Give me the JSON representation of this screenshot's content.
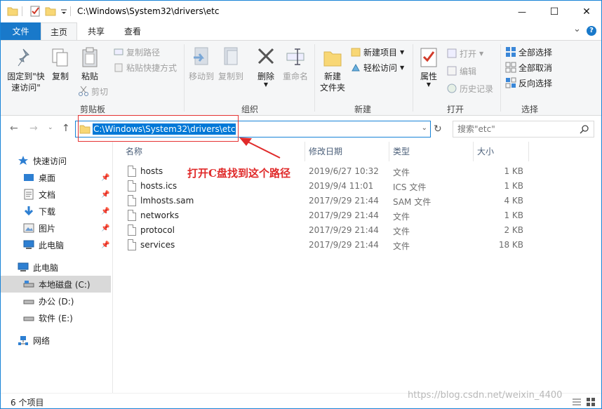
{
  "window": {
    "title": "C:\\Windows\\System32\\drivers\\etc",
    "minimize_glyph": "—",
    "maximize_glyph": "☐",
    "close_glyph": "✕"
  },
  "menu": {
    "file": "文件",
    "tabs": [
      "主页",
      "共享",
      "查看"
    ],
    "expand_glyph": "⌄",
    "help_glyph": "?"
  },
  "ribbon": {
    "clipboard": {
      "label": "剪贴板",
      "pin": "固定到\"快\n速访问\"",
      "copy": "复制",
      "paste": "粘贴",
      "copy_path": "复制路径",
      "paste_shortcut": "粘贴快捷方式",
      "cut": "剪切"
    },
    "organize": {
      "label": "组织",
      "move_to": "移动到",
      "copy_to": "复制到",
      "delete": "删除",
      "rename": "重命名"
    },
    "new": {
      "label": "新建",
      "new_folder": "新建\n文件夹",
      "new_item": "新建项目",
      "easy_access": "轻松访问"
    },
    "open": {
      "label": "打开",
      "properties": "属性",
      "open": "打开",
      "edit": "编辑",
      "history": "历史记录"
    },
    "select": {
      "label": "选择",
      "select_all": "全部选择",
      "select_none": "全部取消",
      "invert": "反向选择"
    }
  },
  "address": {
    "path": "C:\\Windows\\System32\\drivers\\etc",
    "search_placeholder": "搜索\"etc\""
  },
  "nav": {
    "quick_access": "快速访问",
    "desktop": "桌面",
    "documents": "文档",
    "downloads": "下载",
    "pictures": "图片",
    "this_pc_quick": "此电脑",
    "this_pc": "此电脑",
    "drive_c": "本地磁盘 (C:)",
    "drive_d": "办公 (D:)",
    "drive_e": "软件 (E:)",
    "network": "网络"
  },
  "columns": {
    "name": "名称",
    "modified": "修改日期",
    "type": "类型",
    "size": "大小"
  },
  "files": [
    {
      "name": "hosts",
      "modified": "2019/6/27 10:32",
      "type": "文件",
      "size": "1 KB"
    },
    {
      "name": "hosts.ics",
      "modified": "2019/9/4 11:01",
      "type": "ICS 文件",
      "size": "1 KB"
    },
    {
      "name": "lmhosts.sam",
      "modified": "2017/9/29 21:44",
      "type": "SAM 文件",
      "size": "4 KB"
    },
    {
      "name": "networks",
      "modified": "2017/9/29 21:44",
      "type": "文件",
      "size": "1 KB"
    },
    {
      "name": "protocol",
      "modified": "2017/9/29 21:44",
      "type": "文件",
      "size": "2 KB"
    },
    {
      "name": "services",
      "modified": "2017/9/29 21:44",
      "type": "文件",
      "size": "18 KB"
    }
  ],
  "annotation": "打开C盘找到这个路径",
  "status": {
    "count": "6 个项目"
  },
  "watermark": "https://blog.csdn.net/weixin_4400",
  "colors": {
    "accent": "#1979ca",
    "annotation": "#e02a2a",
    "folder": "#f8d775"
  }
}
